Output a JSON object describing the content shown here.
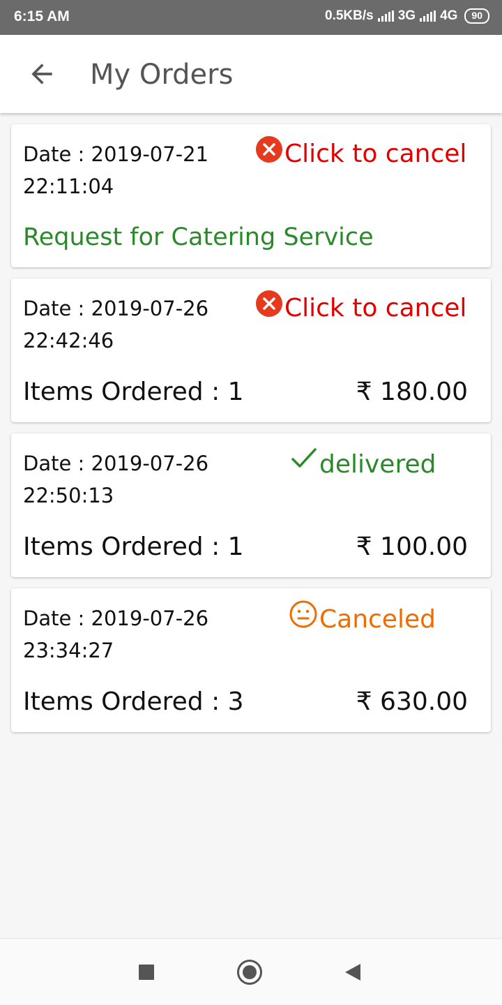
{
  "status_bar": {
    "time": "6:15 AM",
    "speed": "0.5KB/s",
    "net1": "3G",
    "net2": "4G",
    "battery": "90"
  },
  "header": {
    "title": "My Orders",
    "back_icon": "arrow-left-icon"
  },
  "orders": [
    {
      "date_label": "Date : 2019-07-21",
      "time": "22:11:04",
      "status": "Click to cancel",
      "status_icon": "cancel-circle-icon",
      "description": "Request for Catering Service"
    },
    {
      "date_label": "Date : 2019-07-26",
      "time": "22:42:46",
      "status": "Click to cancel",
      "status_icon": "cancel-circle-icon",
      "items": "Items Ordered : 1",
      "price": "₹ 180.00"
    },
    {
      "date_label": "Date : 2019-07-26",
      "time": "22:50:13",
      "status": "delivered",
      "status_icon": "check-icon",
      "items": "Items Ordered : 1",
      "price": "₹ 100.00"
    },
    {
      "date_label": "Date : 2019-07-26",
      "time": "23:34:27",
      "status": "Canceled",
      "status_icon": "neutral-face-icon",
      "items": "Items Ordered : 3",
      "price": "₹ 630.00"
    }
  ],
  "colors": {
    "cancel": "#e30000",
    "delivered": "#2a8a2a",
    "canceled": "#ef6c00",
    "catering": "#2a8a2a"
  },
  "nav": {
    "recents_icon": "square-icon",
    "home_icon": "circle-icon",
    "back_icon": "triangle-back-icon"
  }
}
